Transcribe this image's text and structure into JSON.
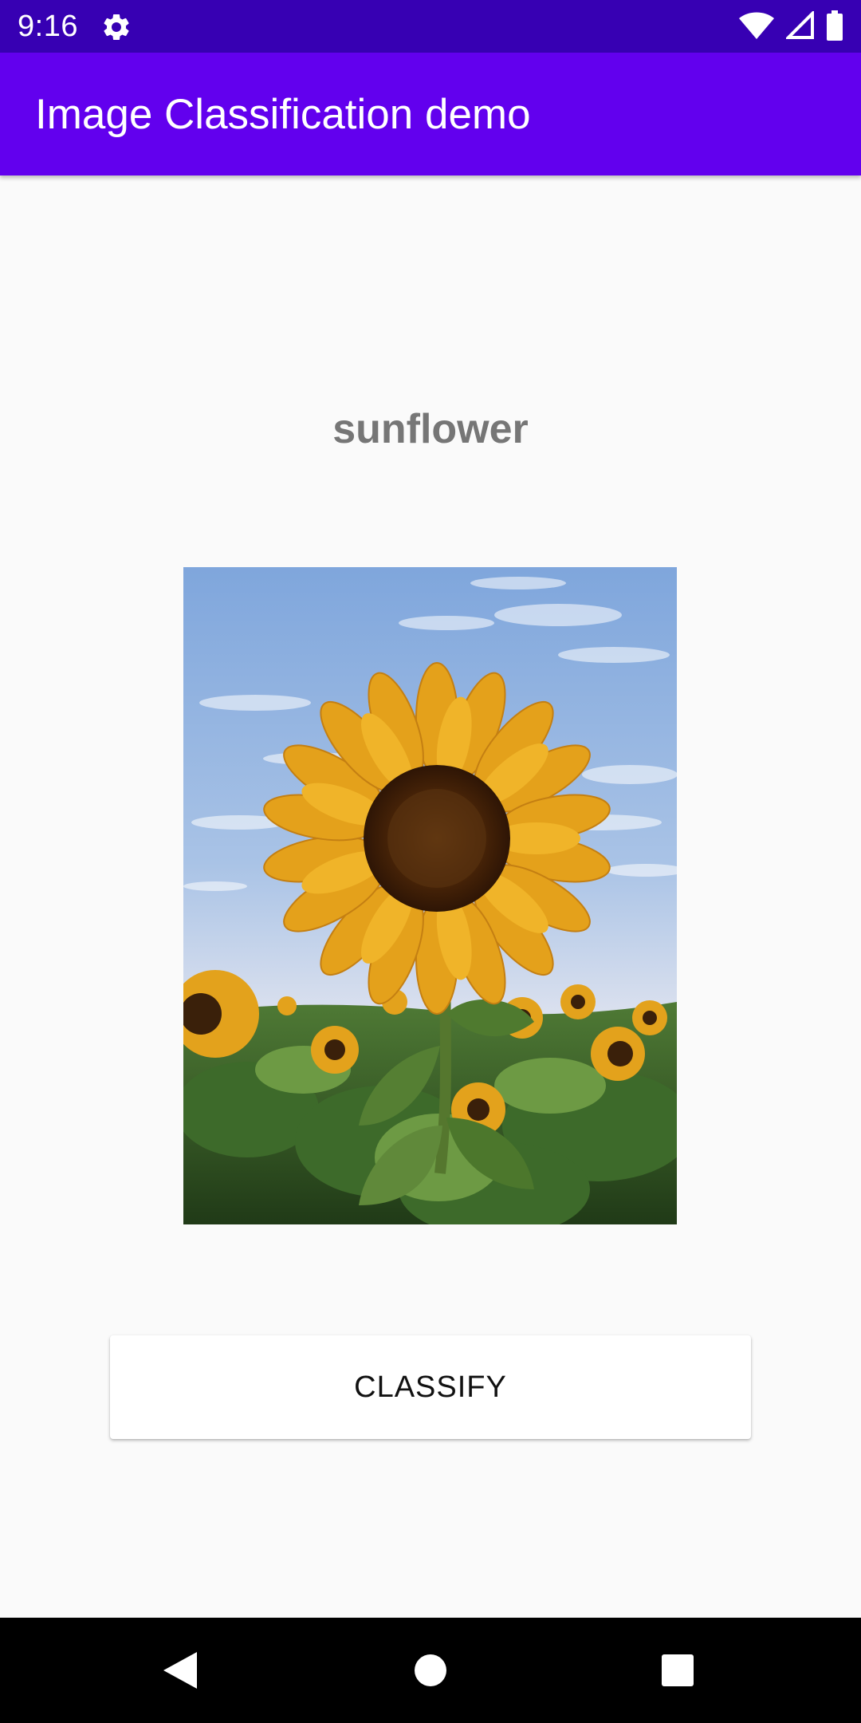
{
  "status_bar": {
    "time": "9:16",
    "icons": [
      "gear-icon",
      "wifi-icon",
      "signal-icon",
      "battery-icon"
    ]
  },
  "app_bar": {
    "title": "Image Classification demo"
  },
  "result": {
    "label": "sunflower"
  },
  "image": {
    "subject": "sunflower-photo"
  },
  "actions": {
    "classify_label": "CLASSIFY"
  },
  "navigation": {
    "icons": [
      "back-icon",
      "home-icon",
      "recents-icon"
    ]
  },
  "colors": {
    "status_bar": "#3700b3",
    "app_bar": "#6200ee",
    "background": "#fafafa",
    "result_text": "#767676",
    "nav_bar": "#000000"
  }
}
